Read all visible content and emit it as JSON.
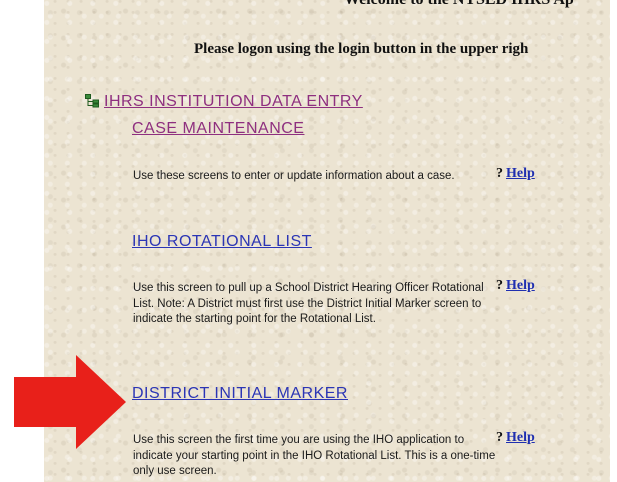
{
  "header": {
    "welcome_text": "Welcome to the NYSED IHRS Ap",
    "logon_prompt": "Please logon using the login button in the upper righ"
  },
  "tree": {
    "icon": "tree-folder-icon",
    "section_title": "IHRS INSTITUTION DATA ENTRY"
  },
  "items": [
    {
      "label": "CASE MAINTENANCE",
      "description": "Use these screens to enter or update information about a case.",
      "help_mark": "?",
      "help_label": "Help"
    },
    {
      "label": "IHO ROTATIONAL LIST",
      "description": "Use this screen to pull up a School District Hearing Officer Rotational List. Note: A District must first use the District Initial Marker screen to indicate the starting point for the Rotational List.",
      "help_mark": "?",
      "help_label": "Help"
    },
    {
      "label": "DISTRICT INITIAL MARKER",
      "description": "Use this screen the first time you are using the IHO application to indicate your starting point in the IHO Rotational List. This is a one-time only use screen.",
      "help_mark": "?",
      "help_label": "Help"
    }
  ],
  "annotation": {
    "arrow_icon": "red-arrow-icon",
    "arrow_color": "#e8201a"
  },
  "colors": {
    "page_background": "#ece4d2",
    "visited_link": "#8e2f7f",
    "link": "#2b35b5",
    "help_link": "#1f2fb0"
  }
}
